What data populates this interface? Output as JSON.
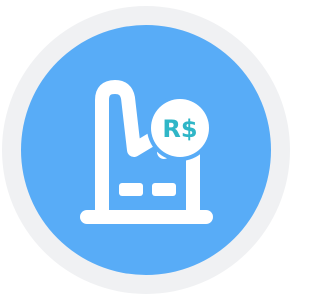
{
  "icon": {
    "name": "factory-revenue-icon",
    "badge_text": "R$",
    "currency_icon": "brazilian-real-icon"
  },
  "colors": {
    "background": "#ffffff",
    "outer_ring": "#f0f1f3",
    "circle": "#58acf7",
    "glyph": "#ffffff",
    "badge_border": "#58acf7",
    "badge_text": "#2fb6c7"
  }
}
